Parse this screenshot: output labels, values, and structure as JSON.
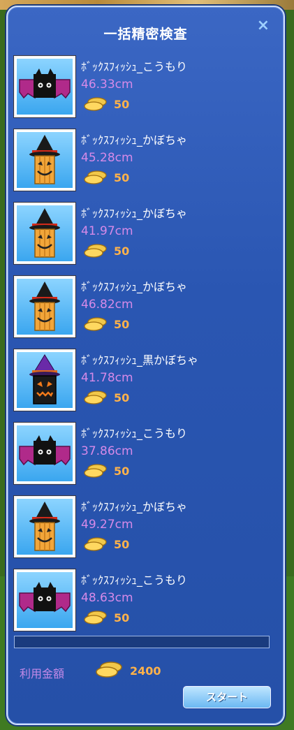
{
  "window": {
    "title": "一括精密検査",
    "close_label": "×"
  },
  "items": [
    {
      "name": "ﾎﾞｯｸｽﾌｨｯｼｭ_こうもり",
      "size": "46.33cm",
      "price": "50",
      "icon": "bat"
    },
    {
      "name": "ﾎﾞｯｸｽﾌｨｯｼｭ_かぼちゃ",
      "size": "45.28cm",
      "price": "50",
      "icon": "pumpkin"
    },
    {
      "name": "ﾎﾞｯｸｽﾌｨｯｼｭ_かぼちゃ",
      "size": "41.97cm",
      "price": "50",
      "icon": "pumpkin"
    },
    {
      "name": "ﾎﾞｯｸｽﾌｨｯｼｭ_かぼちゃ",
      "size": "46.82cm",
      "price": "50",
      "icon": "pumpkin"
    },
    {
      "name": "ﾎﾞｯｸｽﾌｨｯｼｭ_黒かぼちゃ",
      "size": "41.78cm",
      "price": "50",
      "icon": "black-pumpkin"
    },
    {
      "name": "ﾎﾞｯｸｽﾌｨｯｼｭ_こうもり",
      "size": "37.86cm",
      "price": "50",
      "icon": "bat"
    },
    {
      "name": "ﾎﾞｯｸｽﾌｨｯｼｭ_かぼちゃ",
      "size": "49.27cm",
      "price": "50",
      "icon": "pumpkin"
    },
    {
      "name": "ﾎﾞｯｸｽﾌｨｯｼｭ_こうもり",
      "size": "48.63cm",
      "price": "50",
      "icon": "bat"
    }
  ],
  "progress": {
    "fraction": 0
  },
  "footer": {
    "total_label": "利用金額",
    "total_value": "2400",
    "start_label": "スタート"
  },
  "colors": {
    "size_text": "#d68ae8",
    "price_text": "#ffb24a",
    "panel_bg": "#2a56b2"
  }
}
